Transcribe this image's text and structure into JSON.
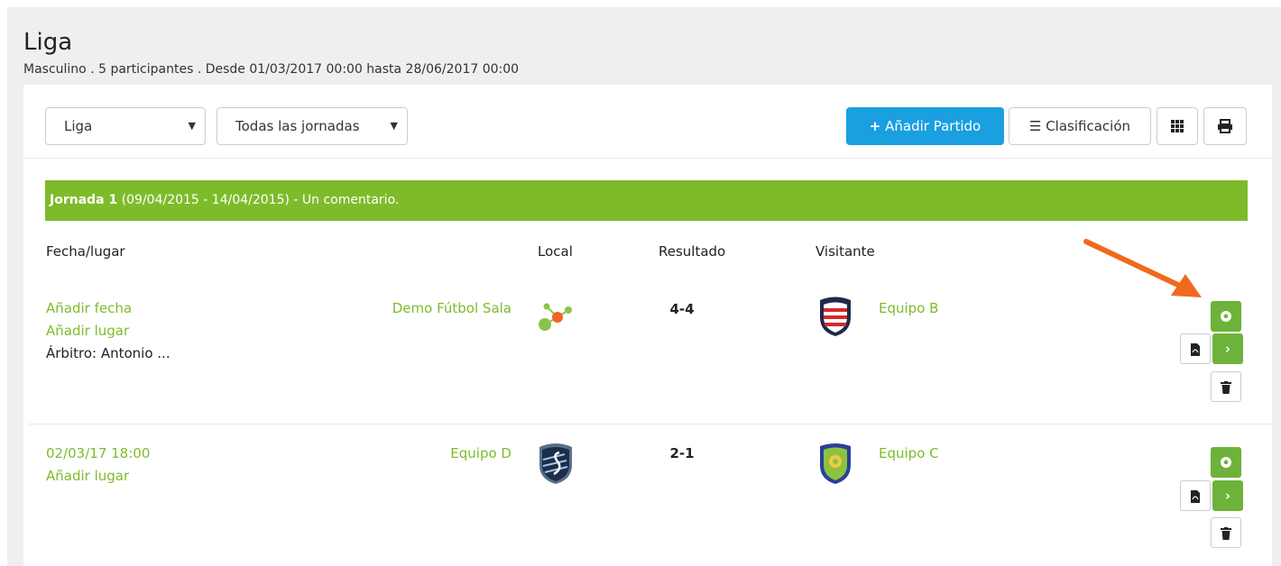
{
  "header": {
    "title": "Liga",
    "subtitle": "Masculino . 5 participantes . Desde 01/03/2017 00:00 hasta 28/06/2017 00:00"
  },
  "toolbar": {
    "competition_select": "Liga",
    "round_select": "Todas las jornadas",
    "add_match_label": "Añadir Partido",
    "standings_label": "Clasificación"
  },
  "jornada": {
    "title": "Jornada 1",
    "detail": "(09/04/2015 - 14/04/2015) - Un comentario."
  },
  "columns": {
    "date_place": "Fecha/lugar",
    "local": "Local",
    "result": "Resultado",
    "visitor": "Visitante"
  },
  "matches": [
    {
      "date": "Añadir fecha",
      "place": "Añadir lugar",
      "referee": "Árbitro: Antonio ...",
      "home": "Demo Fútbol Sala",
      "home_logo": "molecule-logo",
      "score": "4-4",
      "away": "Equipo B",
      "away_logo": "striped-shield-logo"
    },
    {
      "date": "02/03/17 18:00",
      "place": "Añadir lugar",
      "referee": "",
      "home": "Equipo D",
      "home_logo": "blue-crest-logo",
      "score": "2-1",
      "away": "Equipo C",
      "away_logo": "green-shield-logo"
    }
  ],
  "colors": {
    "accent_green": "#7ebb2b",
    "button_green": "#6db23a",
    "primary_blue": "#1a9fe0",
    "arrow_orange": "#f06a1d"
  }
}
